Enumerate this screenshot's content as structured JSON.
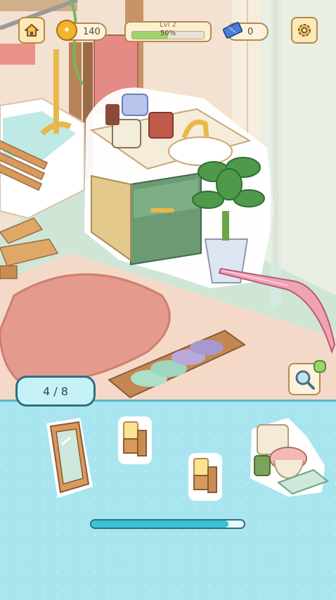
{
  "hud": {
    "coins": "140",
    "level_label": "Lvl 2",
    "level_percent_text": "50%",
    "level_fraction": 0.5,
    "tickets": "0",
    "icons": [
      "home-icon",
      "coin-icon",
      "ticket-icon",
      "gear-icon"
    ]
  },
  "tray": {
    "found_counter": "4 / 8",
    "progress_fraction": 0.9,
    "items": [
      "mirror",
      "wall-lamp",
      "wall-lamp",
      "toilet-set"
    ]
  },
  "scene_icons": [
    "magnifier-icon",
    "pink-tweezers"
  ],
  "colors": {
    "panel_bg": "#a9e5ef",
    "accent": "#2d6f80",
    "progress": "#3ac3d6",
    "level_bar": "#9fd36b"
  }
}
